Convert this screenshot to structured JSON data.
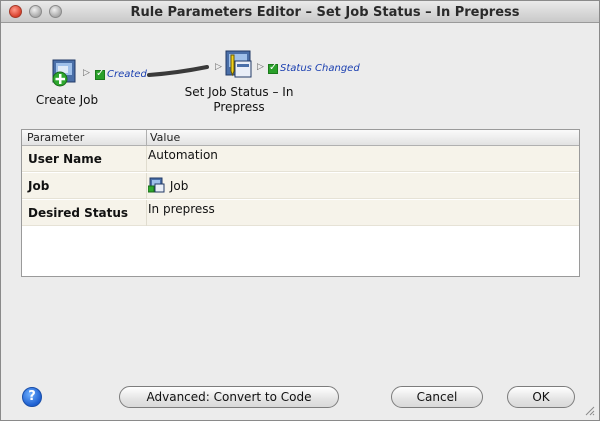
{
  "window": {
    "title": "Rule Parameters Editor – Set Job Status – In Prepress"
  },
  "flow": {
    "source": {
      "label": "Create Job",
      "icon": "create-job-icon"
    },
    "source_event": {
      "label": "Created",
      "checked": true
    },
    "target": {
      "label_line1": "Set Job Status – In",
      "label_line2": "Prepress",
      "icon": "set-job-status-icon"
    },
    "target_event": {
      "label": "Status Changed",
      "checked": true
    }
  },
  "table": {
    "columns": [
      "Parameter",
      "Value"
    ],
    "rows": [
      {
        "parameter": "User Name",
        "value": "Automation"
      },
      {
        "parameter": "Job",
        "value": "Job",
        "value_icon": "job-icon"
      },
      {
        "parameter": "Desired Status",
        "value": "In prepress"
      }
    ]
  },
  "buttons": {
    "help": "?",
    "advanced": "Advanced: Convert to Code",
    "cancel": "Cancel",
    "ok": "OK"
  },
  "colors": {
    "event_label": "#1a3fb0",
    "check": "#2aa02a",
    "row_bg": "#f6f3ea"
  }
}
